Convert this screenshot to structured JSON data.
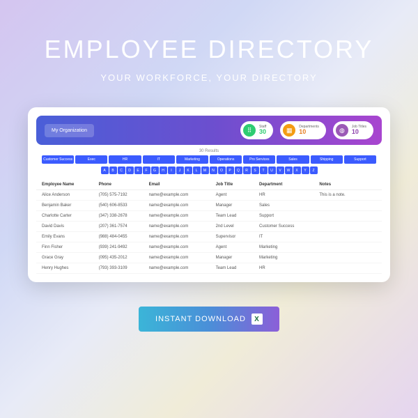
{
  "hero": {
    "title": "EMPLOYEE DIRECTORY",
    "subtitle": "YOUR WORKFORCE, YOUR DIRECTORY"
  },
  "topbar": {
    "org_label": "My Organization",
    "stats": [
      {
        "label": "Staff",
        "value": "30"
      },
      {
        "label": "Departments",
        "value": "10"
      },
      {
        "label": "Job Titles",
        "value": "10"
      }
    ]
  },
  "results_label": "30 Results",
  "departments": [
    "Customer Success",
    "Exec",
    "HR",
    "IT",
    "Marketing",
    "Operations",
    "Pro Services",
    "Sales",
    "Shipping",
    "Support"
  ],
  "alphabet": [
    "A",
    "B",
    "C",
    "D",
    "E",
    "F",
    "G",
    "H",
    "I",
    "J",
    "K",
    "L",
    "M",
    "N",
    "O",
    "P",
    "Q",
    "R",
    "S",
    "T",
    "U",
    "V",
    "W",
    "X",
    "Y",
    "Z"
  ],
  "columns": [
    "Employee Name",
    "Phone",
    "Email",
    "Job Title",
    "Department",
    "Notes"
  ],
  "rows": [
    {
      "name": "Alice Anderson",
      "phone": "(705) 575-7192",
      "email": "name@example.com",
      "title": "Agent",
      "dept": "HR",
      "notes": "This is a note."
    },
    {
      "name": "Benjamin Baker",
      "phone": "(540) 606-8533",
      "email": "name@example.com",
      "title": "Manager",
      "dept": "Sales",
      "notes": ""
    },
    {
      "name": "Charlotte Carter",
      "phone": "(347) 338-2678",
      "email": "name@example.com",
      "title": "Team Lead",
      "dept": "Support",
      "notes": ""
    },
    {
      "name": "David Davis",
      "phone": "(207) 361-7574",
      "email": "name@example.com",
      "title": "2nd Level",
      "dept": "Customer Success",
      "notes": ""
    },
    {
      "name": "Emily Evans",
      "phone": "(988) 484-0455",
      "email": "name@example.com",
      "title": "Supervisor",
      "dept": "IT",
      "notes": ""
    },
    {
      "name": "Finn Fisher",
      "phone": "(939) 241-9492",
      "email": "name@example.com",
      "title": "Agent",
      "dept": "Marketing",
      "notes": ""
    },
    {
      "name": "Grace Gray",
      "phone": "(095) 435-2012",
      "email": "name@example.com",
      "title": "Manager",
      "dept": "Marketing",
      "notes": ""
    },
    {
      "name": "Henry Hughes",
      "phone": "(793) 393-3109",
      "email": "name@example.com",
      "title": "Team Lead",
      "dept": "HR",
      "notes": ""
    }
  ],
  "cta": {
    "label": "INSTANT DOWNLOAD",
    "icon": "X"
  }
}
